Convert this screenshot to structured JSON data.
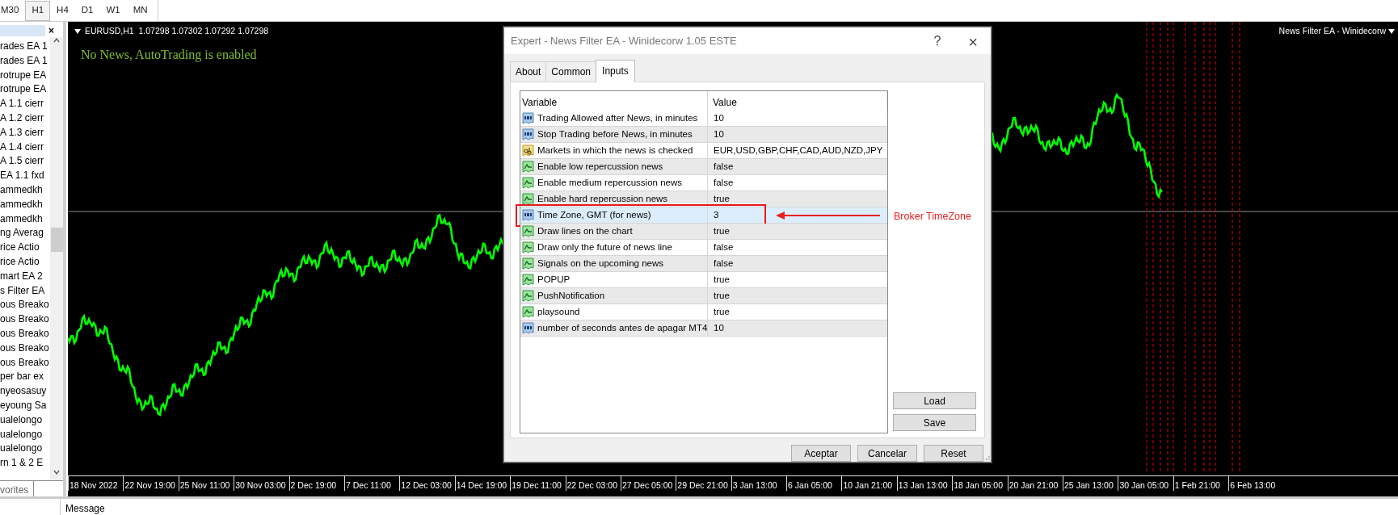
{
  "toolbar": {
    "timeframes": [
      {
        "label": "M30",
        "selected": false
      },
      {
        "label": "H1",
        "selected": true
      },
      {
        "label": "H4",
        "selected": false
      },
      {
        "label": "D1",
        "selected": false
      },
      {
        "label": "W1",
        "selected": false
      },
      {
        "label": "MN",
        "selected": false
      }
    ]
  },
  "navigator": {
    "close_button": "×",
    "items": [
      "rades EA 1",
      "rades EA 1",
      "rotrupe EA",
      "rotrupe EA",
      "A 1.1 cierr",
      "A 1.2 cierr",
      "A 1.3 cierr",
      "A 1.4 cierr",
      "A 1.5 cierr",
      "EA 1.1 fxd",
      "ammedkh",
      "ammedkh",
      "ammedkh",
      "ng Averag",
      "rice Actio",
      "rice Actio",
      "mart EA 2",
      "s Filter EA",
      "ous Breako",
      "ous Breako",
      "ous Breako",
      "ous Breako",
      "ous Breako",
      "per bar ex",
      "nyeosasuy",
      "eyoung Sa",
      "ualelongo",
      "ualelongo",
      "ualelongo",
      "rn 1 & 2 E"
    ],
    "tab": "vorites"
  },
  "chart": {
    "header": "EURUSD,H1  1.07298 1.07302 1.07292 1.07298",
    "status_text": "No News, AutoTrading is enabled",
    "indicator_label": "News Filter EA - Winidecorw",
    "time_labels": [
      "18 Nov 2022",
      "22 Nov 19:00",
      "25 Nov 11:00",
      "30 Nov 03:00",
      "2 Dec 19:00",
      "7 Dec 11:00",
      "12 Dec 03:00",
      "14 Dec 19:00",
      "19 Dec 11:00",
      "22 Dec 03:00",
      "27 Dec 05:00",
      "29 Dec 21:00",
      "3 Jan 13:00",
      "6 Jan 05:00",
      "10 Jan 21:00",
      "13 Jan 13:00",
      "18 Jan 05:00",
      "20 Jan 21:00",
      "25 Jan 13:00",
      "30 Jan 05:00",
      "1 Feb 21:00",
      "6 Feb 13:00"
    ]
  },
  "dialog": {
    "title": "Expert - News Filter EA - Winidecorw 1.05 ESTE",
    "help_button": "?",
    "close_button": "×",
    "tabs": [
      {
        "label": "About",
        "selected": false
      },
      {
        "label": "Common",
        "selected": false
      },
      {
        "label": "Inputs",
        "selected": true
      }
    ],
    "columns": [
      "Variable",
      "Value"
    ],
    "rows": [
      {
        "kind": "int",
        "variable": "Trading Allowed after News, in minutes",
        "value": "10",
        "selected": false
      },
      {
        "kind": "int",
        "variable": "Stop Trading before News, in minutes",
        "value": "10",
        "selected": false
      },
      {
        "kind": "string",
        "variable": "Markets in which the news is checked",
        "value": "EUR,USD,GBP,CHF,CAD,AUD,NZD,JPY",
        "selected": false
      },
      {
        "kind": "bool",
        "variable": "Enable low repercussion news",
        "value": "false",
        "selected": false
      },
      {
        "kind": "bool",
        "variable": "Enable medium repercussion news",
        "value": "false",
        "selected": false
      },
      {
        "kind": "bool",
        "variable": "Enable hard repercussion news",
        "value": "true",
        "selected": false
      },
      {
        "kind": "int",
        "variable": "Time Zone, GMT (for news)",
        "value": "3",
        "selected": true
      },
      {
        "kind": "bool",
        "variable": "Draw lines on the chart",
        "value": "true",
        "selected": false
      },
      {
        "kind": "bool",
        "variable": "Draw only the future of news line",
        "value": "false",
        "selected": false
      },
      {
        "kind": "bool",
        "variable": "Signals on the upcoming news",
        "value": "false",
        "selected": false
      },
      {
        "kind": "bool",
        "variable": "POPUP",
        "value": "true",
        "selected": false
      },
      {
        "kind": "bool",
        "variable": "PushNotification",
        "value": "true",
        "selected": false
      },
      {
        "kind": "bool",
        "variable": "playsound",
        "value": "true",
        "selected": false
      },
      {
        "kind": "int",
        "variable": "number of seconds antes de apagar MT4",
        "value": "10",
        "selected": false
      }
    ],
    "side_buttons": [
      "Load",
      "Save"
    ],
    "buttons": [
      "Aceptar",
      "Cancelar",
      "Reset"
    ],
    "annotation": {
      "label": "Broker TimeZone"
    }
  },
  "bottom_panel": {
    "column": "Message"
  }
}
